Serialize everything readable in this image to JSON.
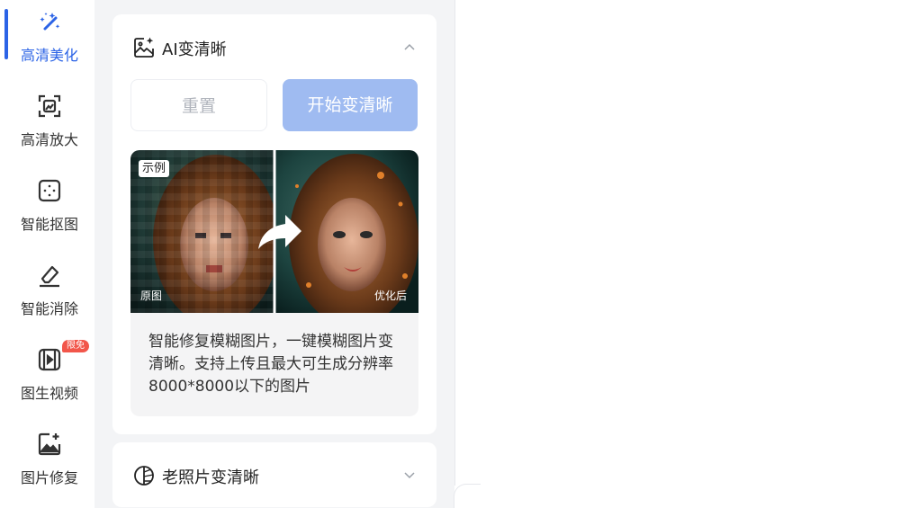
{
  "sidebar": {
    "items": [
      {
        "label": "高清美化",
        "icon": "magic-wand-icon",
        "active": true
      },
      {
        "label": "高清放大",
        "icon": "upscale-icon",
        "active": false
      },
      {
        "label": "智能抠图",
        "icon": "cutout-icon",
        "active": false
      },
      {
        "label": "智能消除",
        "icon": "eraser-icon",
        "active": false
      },
      {
        "label": "图生视频",
        "icon": "video-icon",
        "active": false,
        "badge": "限免"
      },
      {
        "label": "图片修复",
        "icon": "image-repair-icon",
        "active": false
      }
    ]
  },
  "card_ai": {
    "title": "AI变清晰",
    "icon": "image-sparkle-icon",
    "reset_label": "重置",
    "start_label": "开始变清晰",
    "example_tag": "示例",
    "label_original": "原图",
    "label_optimized": "优化后",
    "description": "智能修复模糊图片，一键模糊图片变清晰。支持上传且最大可生成分辨率8000*8000以下的图片"
  },
  "card_old_photo": {
    "title": "老照片变清晰",
    "icon": "half-circle-icon"
  },
  "colors": {
    "accent": "#2b63e6",
    "button_disabled": "#9fbbf1",
    "badge": "#f2564a",
    "panel_bg": "#f3f4f6"
  }
}
